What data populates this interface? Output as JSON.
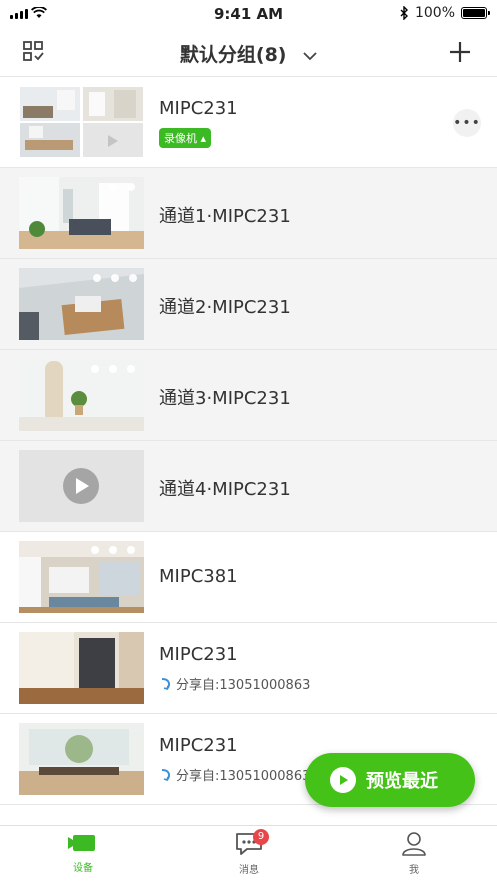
{
  "status_bar": {
    "time": "9:41 AM",
    "battery": "100%"
  },
  "header": {
    "title": "默认分组(8)"
  },
  "devices": [
    {
      "name": "MIPC231",
      "badge": "录像机"
    },
    {
      "name": "通道1·MIPC231"
    },
    {
      "name": "通道2·MIPC231"
    },
    {
      "name": "通道3·MIPC231"
    },
    {
      "name": "通道4·MIPC231"
    },
    {
      "name": "MIPC381"
    },
    {
      "name": "MIPC231",
      "shared": "分享自:13051000863"
    },
    {
      "name": "MIPC231",
      "shared": "分享自:13051000863"
    }
  ],
  "fab": {
    "label": "预览最近"
  },
  "tabbar": {
    "tabs": [
      {
        "label": "设备"
      },
      {
        "label": "消息",
        "badge": "9"
      },
      {
        "label": "我"
      }
    ]
  },
  "colors": {
    "accent": "#3cba23",
    "fab": "#44c217",
    "badge": "#e8474a"
  }
}
